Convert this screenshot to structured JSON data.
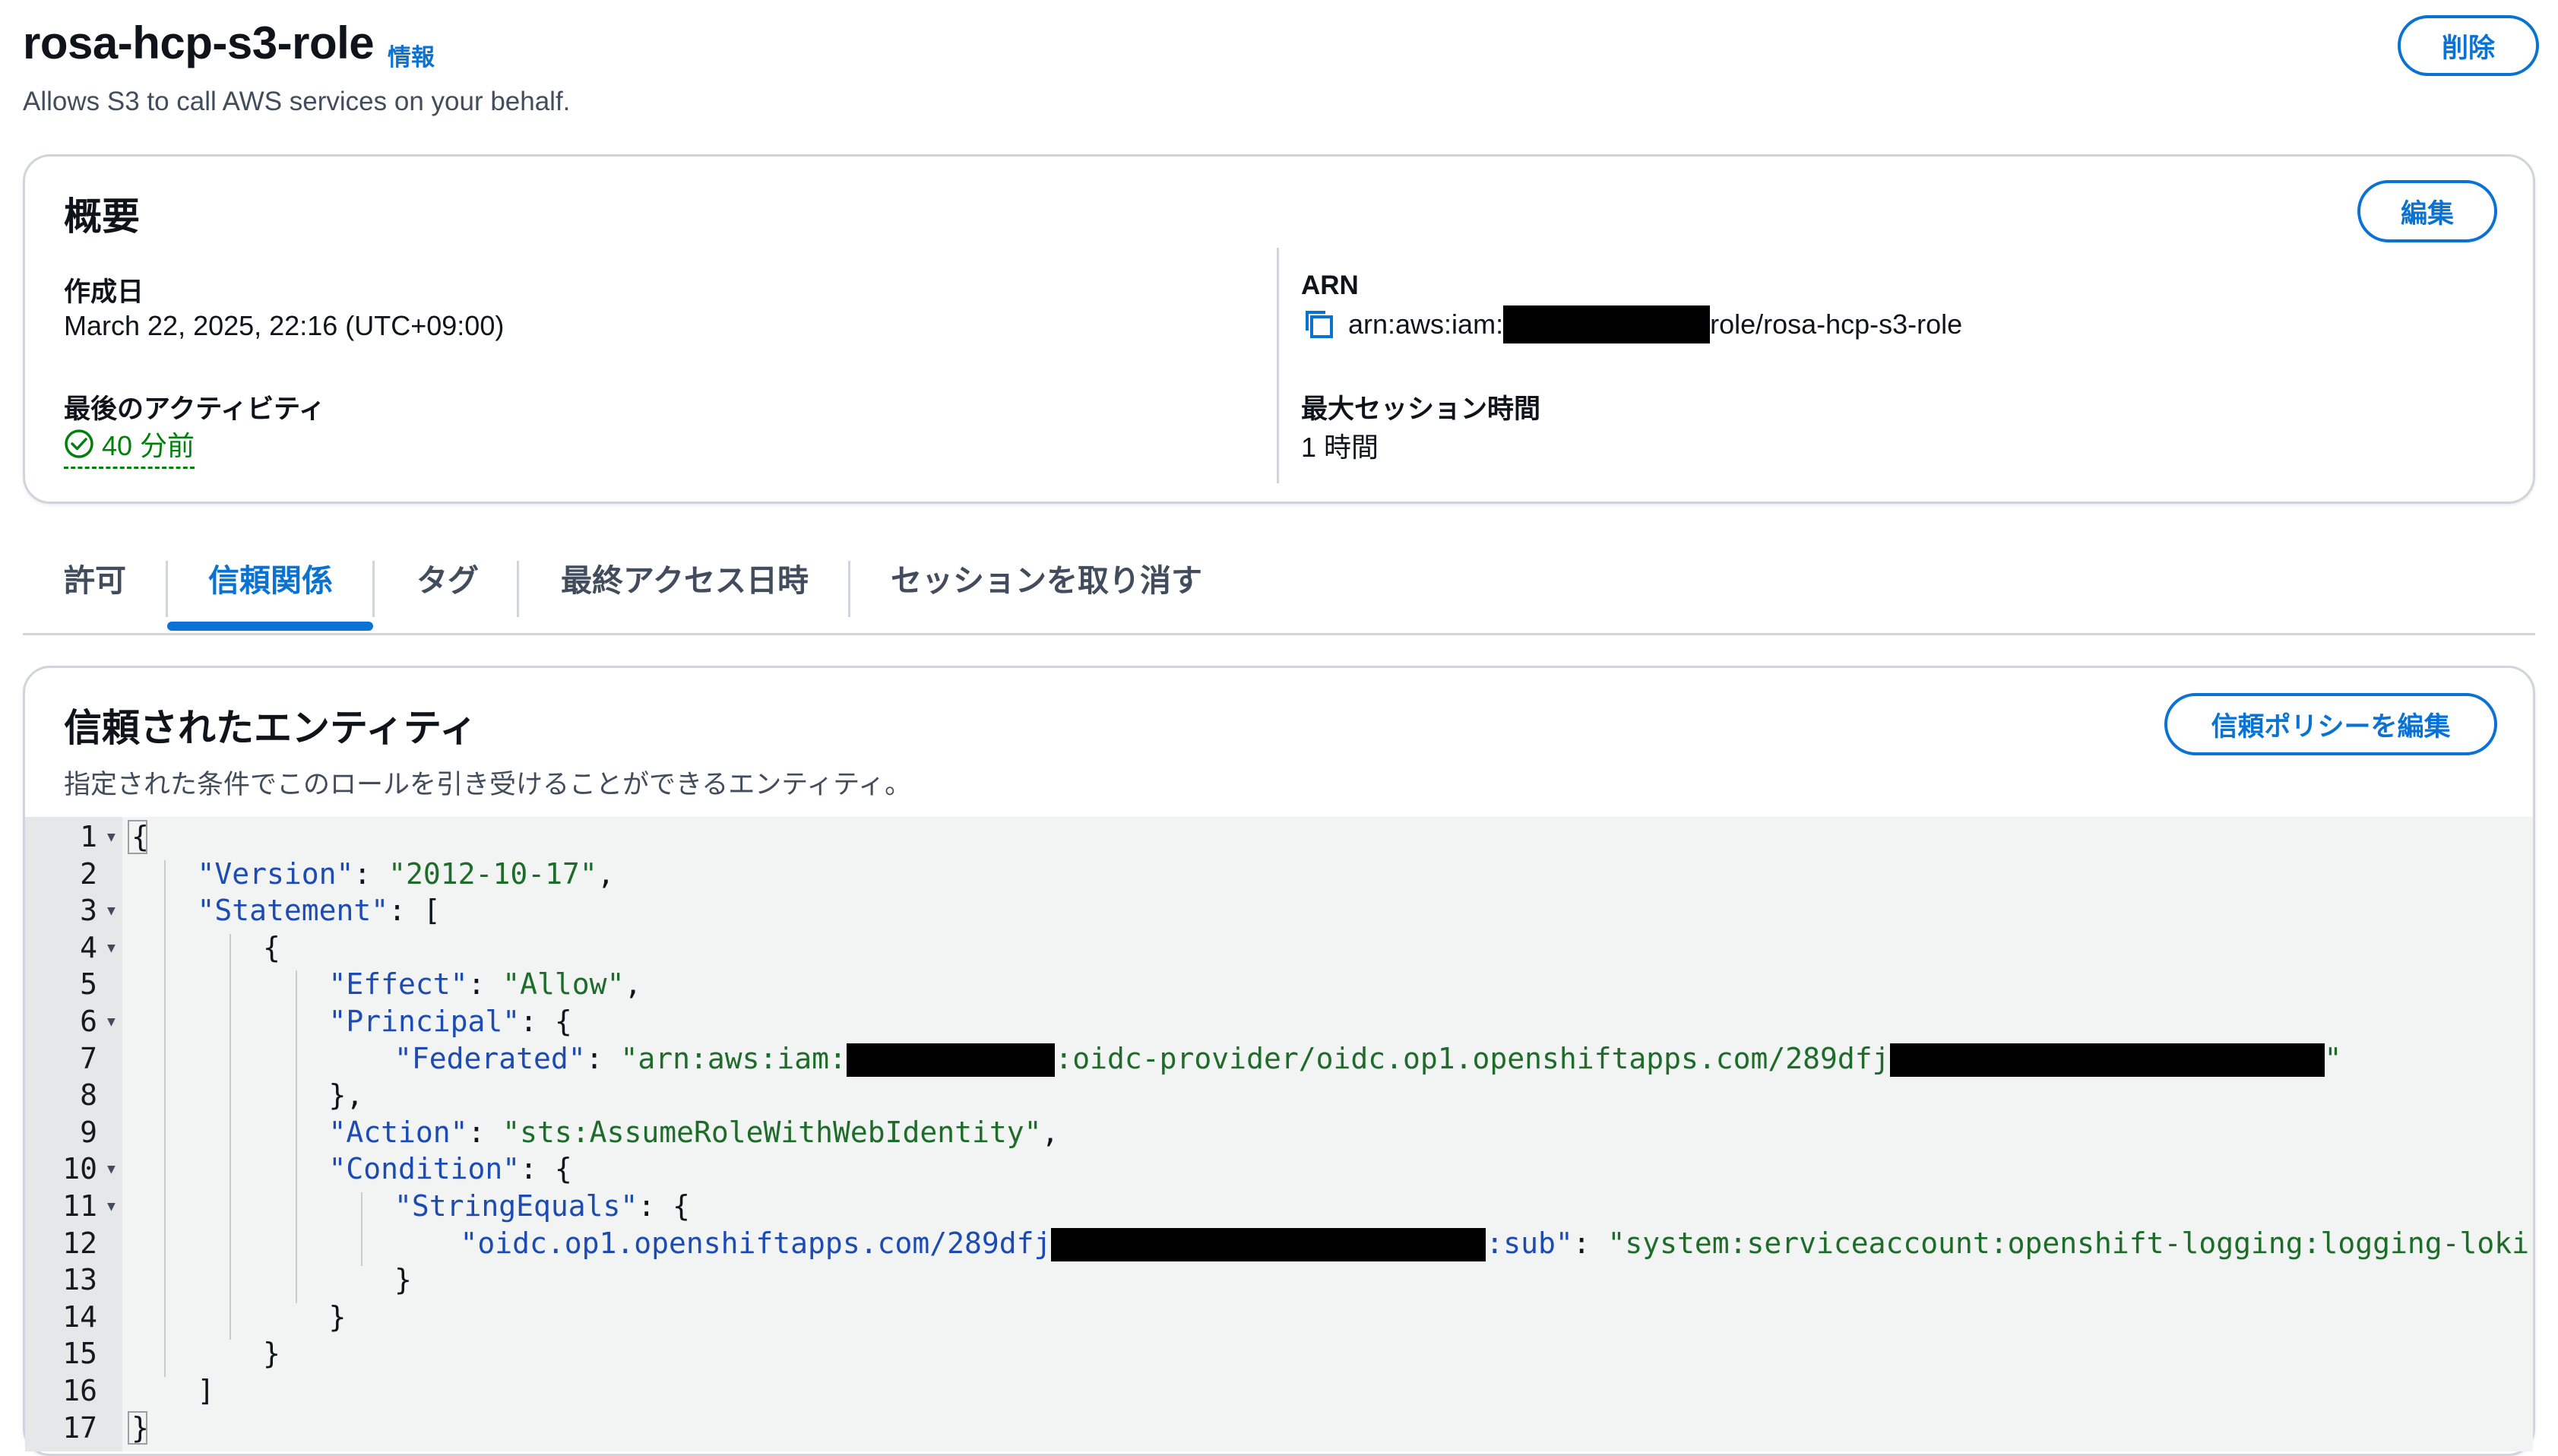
{
  "header": {
    "title": "rosa-hcp-s3-role",
    "info_link": "情報",
    "description": "Allows S3 to call AWS services on your behalf.",
    "delete_label": "削除"
  },
  "summary": {
    "title": "概要",
    "edit_label": "編集",
    "created_label": "作成日",
    "created_value": "March 22, 2025, 22:16 (UTC+09:00)",
    "activity_label": "最後のアクティビティ",
    "activity_value": "40 分前",
    "arn_label": "ARN",
    "arn_prefix": "arn:aws:iam:",
    "arn_suffix": "role/rosa-hcp-s3-role",
    "session_label": "最大セッション時間",
    "session_value": "1 時間"
  },
  "tabs": [
    {
      "label": "許可",
      "active": false
    },
    {
      "label": "信頼関係",
      "active": true
    },
    {
      "label": "タグ",
      "active": false
    },
    {
      "label": "最終アクセス日時",
      "active": false
    },
    {
      "label": "セッションを取り消す",
      "active": false
    }
  ],
  "trust": {
    "title": "信頼されたエンティティ",
    "description": "指定された条件でこのロールを引き受けることができるエンティティ。",
    "edit_policy_label": "信頼ポリシーを編集"
  },
  "policy": {
    "line_numbers": [
      "1",
      "2",
      "3",
      "4",
      "5",
      "6",
      "7",
      "8",
      "9",
      "10",
      "11",
      "12",
      "13",
      "14",
      "15",
      "16",
      "17"
    ],
    "foldable_lines": [
      1,
      3,
      4,
      6,
      10,
      11
    ],
    "lines": [
      {
        "indent": 0,
        "parts": [
          {
            "t": "p",
            "v": "{"
          }
        ]
      },
      {
        "indent": 1,
        "parts": [
          {
            "t": "k",
            "v": "\"Version\""
          },
          {
            "t": "p",
            "v": ": "
          },
          {
            "t": "s",
            "v": "\"2012-10-17\""
          },
          {
            "t": "p",
            "v": ","
          }
        ]
      },
      {
        "indent": 1,
        "parts": [
          {
            "t": "k",
            "v": "\"Statement\""
          },
          {
            "t": "p",
            "v": ": ["
          }
        ]
      },
      {
        "indent": 2,
        "parts": [
          {
            "t": "p",
            "v": "{"
          }
        ]
      },
      {
        "indent": 3,
        "parts": [
          {
            "t": "k",
            "v": "\"Effect\""
          },
          {
            "t": "p",
            "v": ": "
          },
          {
            "t": "s",
            "v": "\"Allow\""
          },
          {
            "t": "p",
            "v": ","
          }
        ]
      },
      {
        "indent": 3,
        "parts": [
          {
            "t": "k",
            "v": "\"Principal\""
          },
          {
            "t": "p",
            "v": ": {"
          }
        ]
      },
      {
        "indent": 4,
        "parts": [
          {
            "t": "k",
            "v": "\"Federated\""
          },
          {
            "t": "p",
            "v": ": "
          },
          {
            "t": "s",
            "v": "\"arn:aws:iam:"
          },
          {
            "t": "r",
            "v": "            "
          },
          {
            "t": "s",
            "v": ":oidc-provider/oidc.op1.openshiftapps.com/289dfj"
          },
          {
            "t": "r",
            "v": "                         "
          },
          {
            "t": "s",
            "v": "\""
          }
        ]
      },
      {
        "indent": 3,
        "parts": [
          {
            "t": "p",
            "v": "},"
          }
        ]
      },
      {
        "indent": 3,
        "parts": [
          {
            "t": "k",
            "v": "\"Action\""
          },
          {
            "t": "p",
            "v": ": "
          },
          {
            "t": "s",
            "v": "\"sts:AssumeRoleWithWebIdentity\""
          },
          {
            "t": "p",
            "v": ","
          }
        ]
      },
      {
        "indent": 3,
        "parts": [
          {
            "t": "k",
            "v": "\"Condition\""
          },
          {
            "t": "p",
            "v": ": {"
          }
        ]
      },
      {
        "indent": 4,
        "parts": [
          {
            "t": "k",
            "v": "\"StringEquals\""
          },
          {
            "t": "p",
            "v": ": {"
          }
        ]
      },
      {
        "indent": 5,
        "parts": [
          {
            "t": "k",
            "v": "\"oidc.op1.openshiftapps.com/289dfj"
          },
          {
            "t": "r",
            "v": "                         "
          },
          {
            "t": "k",
            "v": ":sub\""
          },
          {
            "t": "p",
            "v": ": "
          },
          {
            "t": "s",
            "v": "\"system:serviceaccount:openshift-logging:logging-loki\""
          }
        ]
      },
      {
        "indent": 4,
        "parts": [
          {
            "t": "p",
            "v": "}"
          }
        ]
      },
      {
        "indent": 3,
        "parts": [
          {
            "t": "p",
            "v": "}"
          }
        ]
      },
      {
        "indent": 2,
        "parts": [
          {
            "t": "p",
            "v": "}"
          }
        ]
      },
      {
        "indent": 1,
        "parts": [
          {
            "t": "p",
            "v": "]"
          }
        ]
      },
      {
        "indent": 0,
        "parts": [
          {
            "t": "p",
            "v": "}"
          }
        ]
      }
    ]
  },
  "colors": {
    "accent": "#0972d3",
    "success": "#037f0c",
    "json_key": "#1c4bb3",
    "json_string": "#1d6c2a"
  }
}
